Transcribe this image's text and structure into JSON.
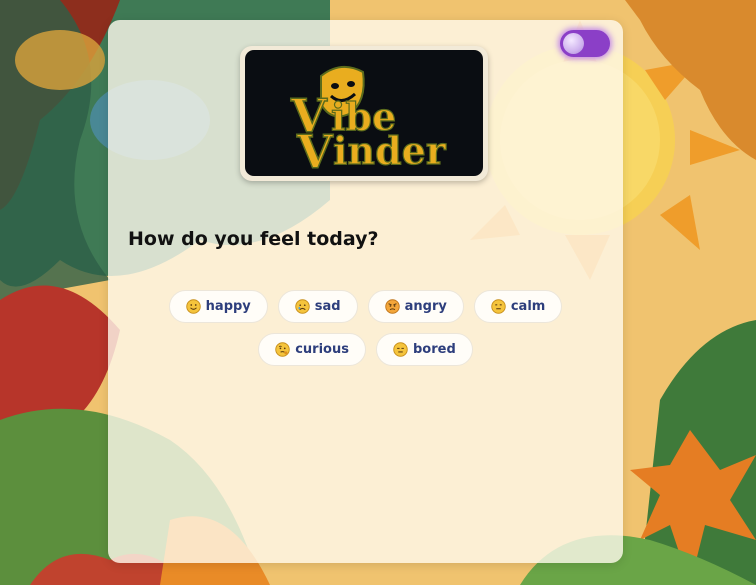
{
  "logo": {
    "line1": "ibe",
    "line2": "inder",
    "initials": "V"
  },
  "toggle": {
    "state": "on"
  },
  "question": "How do you feel today?",
  "moods": [
    {
      "label": "happy",
      "icon": "happy-face-icon"
    },
    {
      "label": "sad",
      "icon": "sad-face-icon"
    },
    {
      "label": "angry",
      "icon": "angry-face-icon"
    },
    {
      "label": "calm",
      "icon": "calm-face-icon"
    },
    {
      "label": "curious",
      "icon": "curious-face-icon"
    },
    {
      "label": "bored",
      "icon": "bored-face-icon"
    }
  ],
  "colors": {
    "accent": "#8b3fc7",
    "chip_text": "#2d3e7c",
    "logo_gold": "#e9ad1f",
    "logo_bg": "#0a0d12"
  }
}
